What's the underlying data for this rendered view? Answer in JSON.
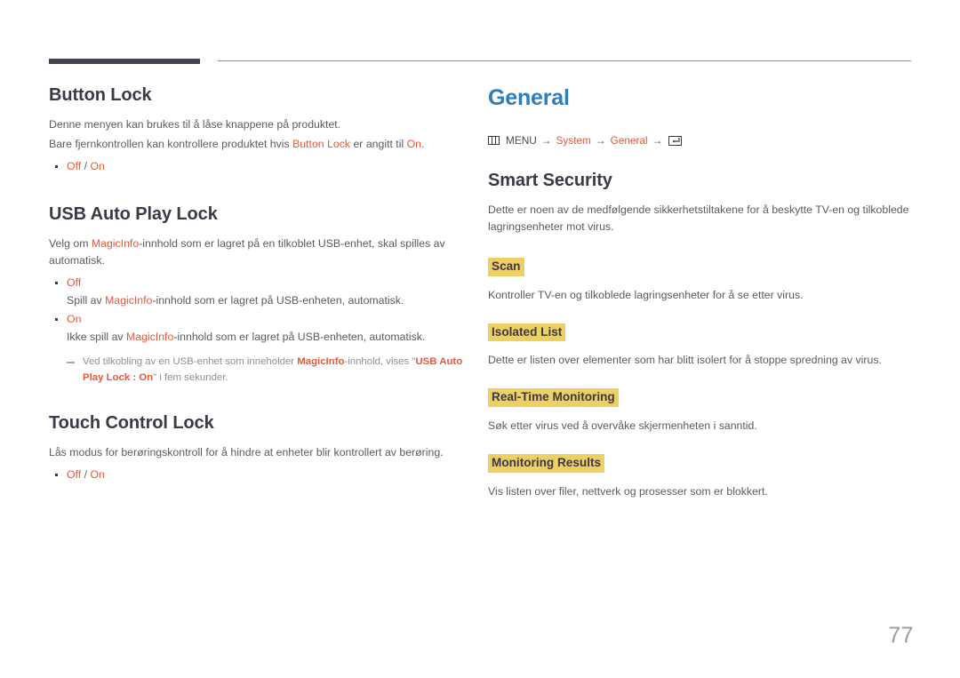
{
  "document": {
    "page_number": "77"
  },
  "left_column": {
    "sections": [
      {
        "title": "Button Lock",
        "paragraphs": [
          {
            "parts": [
              {
                "text": "Denne menyen kan brukes til å låse knappene på produktet.",
                "style": "normal"
              }
            ]
          },
          {
            "parts": [
              {
                "text": "Bare fjernkontrollen kan kontrollere produktet hvis ",
                "style": "normal"
              },
              {
                "text": "Button Lock",
                "style": "orange"
              },
              {
                "text": " er angitt til ",
                "style": "normal"
              },
              {
                "text": "On",
                "style": "orange"
              },
              {
                "text": ".",
                "style": "normal"
              }
            ]
          }
        ],
        "bullets": [
          {
            "option": "Off",
            "separator": " / ",
            "option2": "On"
          }
        ]
      },
      {
        "title": "USB Auto Play Lock",
        "paragraphs": [
          {
            "parts": [
              {
                "text": "Velg om ",
                "style": "normal"
              },
              {
                "text": "MagicInfo",
                "style": "orange"
              },
              {
                "text": "-innhold som er lagret på en tilkoblet USB-enhet, skal spilles av automatisk.",
                "style": "normal"
              }
            ]
          }
        ],
        "bullets": [
          {
            "option": "Off",
            "sub_parts": [
              {
                "text": "Spill av ",
                "style": "normal"
              },
              {
                "text": "MagicInfo",
                "style": "orange"
              },
              {
                "text": "-innhold som er lagret på USB-enheten, automatisk.",
                "style": "normal"
              }
            ]
          },
          {
            "option": "On",
            "sub_parts": [
              {
                "text": "Ikke spill av ",
                "style": "normal"
              },
              {
                "text": "MagicInfo",
                "style": "orange"
              },
              {
                "text": "-innhold som er lagret på USB-enheten, automatisk.",
                "style": "normal"
              }
            ]
          }
        ],
        "note_parts": [
          {
            "text": "Ved tilkobling av en USB-enhet som inneholder ",
            "style": "normal"
          },
          {
            "text": "MagicInfo",
            "style": "hl"
          },
          {
            "text": "-innhold, vises \"",
            "style": "normal"
          },
          {
            "text": "USB Auto Play Lock : On",
            "style": "hl"
          },
          {
            "text": "\" i fem sekunder.",
            "style": "normal"
          }
        ]
      },
      {
        "title": "Touch Control Lock",
        "paragraphs": [
          {
            "parts": [
              {
                "text": "Lås modus for berøringskontroll for å hindre at enheter blir kontrollert av berøring.",
                "style": "normal"
              }
            ]
          }
        ],
        "bullets": [
          {
            "option": "Off",
            "separator": " / ",
            "option2": "On"
          }
        ]
      }
    ]
  },
  "right_column": {
    "chapter_title": "General",
    "breadcrumb": {
      "menu_icon": "menu-grid-icon",
      "menu_label": "MENU",
      "arrow": "→",
      "crumb1": "System",
      "crumb2": "General",
      "enter_icon": "enter-key-icon"
    },
    "section_title": "Smart Security",
    "intro": "Dette er noen av de medfølgende sikkerhetstiltakene for å beskytte TV-en og tilkoblede lagringsenheter mot virus.",
    "items": [
      {
        "label": "Scan",
        "description": "Kontroller TV-en og tilkoblede lagringsenheter for å se etter virus."
      },
      {
        "label": "Isolated List",
        "description": "Dette er listen over elementer som har blitt isolert for å stoppe spredning av virus."
      },
      {
        "label": "Real-Time Monitoring",
        "description": "Søk etter virus ved å overvåke skjermenheten i sanntid."
      },
      {
        "label": "Monitoring Results",
        "description": "Vis listen over filer, nettverk og prosesser som er blokkert."
      }
    ]
  },
  "colors": {
    "accent_orange": "#e4593b",
    "chapter_blue": "#2e7dbf",
    "highlight_yellow": "#edd064",
    "heading_dark": "#3d3746",
    "body_gray": "#5a5a62",
    "note_gray": "#8e8e96",
    "rule_dark": "#474350",
    "rule_light": "#8a8a90",
    "page_number_gray": "#9a9aa2"
  }
}
